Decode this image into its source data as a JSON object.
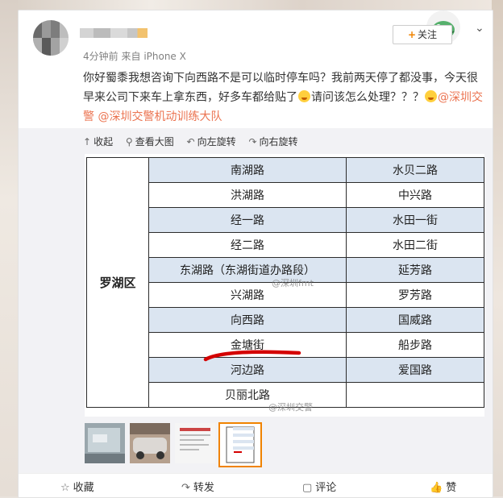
{
  "post": {
    "time": "4分钟前",
    "source_prefix": "来自",
    "source": "iPhone X",
    "follow_label": "关注",
    "text_1": "你好蜀黍我想咨询下向西路不是可以临时停车吗？我前两天停了都没事，今天很早来公司下来车上拿东西，好多车都给贴了",
    "text_2": "请问该怎么处理？？？",
    "mention_1": "@深圳交警",
    "mention_2": "@深圳交警机动训练大队"
  },
  "toolbar": {
    "collapse": "收起",
    "view_large": "查看大图",
    "rotate_left": "向左旋转",
    "rotate_right": "向右旋转"
  },
  "table": {
    "district": "罗湖区",
    "rows": [
      [
        "南湖路",
        "水贝二路"
      ],
      [
        "洪湖路",
        "中兴路"
      ],
      [
        "经一路",
        "水田一街"
      ],
      [
        "经二路",
        "水田二街"
      ],
      [
        "东湖路（东湖街道办路段）",
        "延芳路"
      ],
      [
        "兴湖路",
        "罗芳路"
      ],
      [
        "向西路",
        "国威路"
      ],
      [
        "金塘街",
        "船步路"
      ],
      [
        "河边路",
        "爱国路"
      ],
      [
        "贝丽北路",
        ""
      ]
    ]
  },
  "watermarks": {
    "w1": "@深圳fmt",
    "w2": "@深圳交警"
  },
  "actions": {
    "favorite": "收藏",
    "repost": "转发",
    "comment": "评论",
    "like": "赞"
  },
  "colors": {
    "mention": "#eb7350",
    "table_shade": "#dbe5f1",
    "accent": "#f08300",
    "red_mark": "#d40000"
  },
  "icons": [
    "collapse-icon",
    "zoom-icon",
    "rotate-left-icon",
    "rotate-right-icon",
    "star-icon",
    "repost-icon",
    "comment-icon",
    "like-icon",
    "chevron-down-icon"
  ]
}
